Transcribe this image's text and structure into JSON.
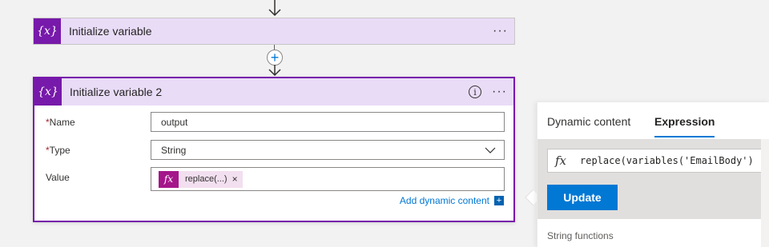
{
  "flow": {
    "card1": {
      "icon": "{x}",
      "title": "Initialize variable",
      "more": "···"
    },
    "card2": {
      "icon": "{x}",
      "title": "Initialize variable 2",
      "info": "i",
      "more": "···",
      "fields": {
        "name": {
          "required": "*",
          "label": "Name",
          "value": "output"
        },
        "type": {
          "required": "*",
          "label": "Type",
          "value": "String"
        },
        "value": {
          "label": "Value",
          "token_icon": "fx",
          "token_label": "replace(...)",
          "token_remove": "×"
        }
      },
      "add_dynamic": {
        "label": "Add dynamic content",
        "icon": "+"
      }
    },
    "insert_step": "+"
  },
  "panel": {
    "tabs": [
      {
        "label": "Dynamic content",
        "active": false
      },
      {
        "label": "Expression",
        "active": true
      }
    ],
    "expression": {
      "icon": "fx",
      "text": "replace(variables('EmailBody')"
    },
    "update_label": "Update",
    "section_label": "String functions"
  },
  "colors": {
    "accent_purple": "#7719aa",
    "header_lilac": "#e9dcf7",
    "token_magenta": "#a4168a",
    "primary_blue": "#0078d4"
  }
}
